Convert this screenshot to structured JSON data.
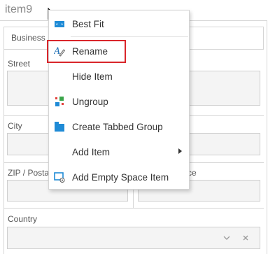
{
  "layout_group": {
    "title": "item9"
  },
  "tabbed_group": {
    "tab_label": "Business"
  },
  "fields": {
    "street": {
      "label": "Street",
      "value": ""
    },
    "city": {
      "label": "City",
      "value": ""
    },
    "zip": {
      "label": "ZIP / Postal",
      "value": ""
    },
    "province_partial": {
      "label": "ce",
      "value": ""
    },
    "country": {
      "label": "Country",
      "value": ""
    }
  },
  "country_combo": {
    "dropdown_icon": "chevron-down-icon",
    "clear_icon": "close-icon"
  },
  "context_menu": {
    "items": [
      {
        "label": "Best Fit",
        "icon": "best-fit-icon"
      },
      {
        "label": "Rename",
        "icon": "rename-icon",
        "highlighted": true
      },
      {
        "label": "Hide Item",
        "icon": ""
      },
      {
        "label": "Ungroup",
        "icon": "ungroup-icon"
      },
      {
        "label": "Create Tabbed Group",
        "icon": "tabbed-group-icon"
      },
      {
        "label": "Add Item",
        "icon": "",
        "has_submenu": true
      },
      {
        "label": "Add Empty Space Item",
        "icon": "empty-space-icon"
      }
    ]
  },
  "colors": {
    "highlight_border": "#d9262b",
    "icon_blue": "#1f8bd6",
    "icon_green": "#3aa54a",
    "icon_red": "#e2413b"
  }
}
